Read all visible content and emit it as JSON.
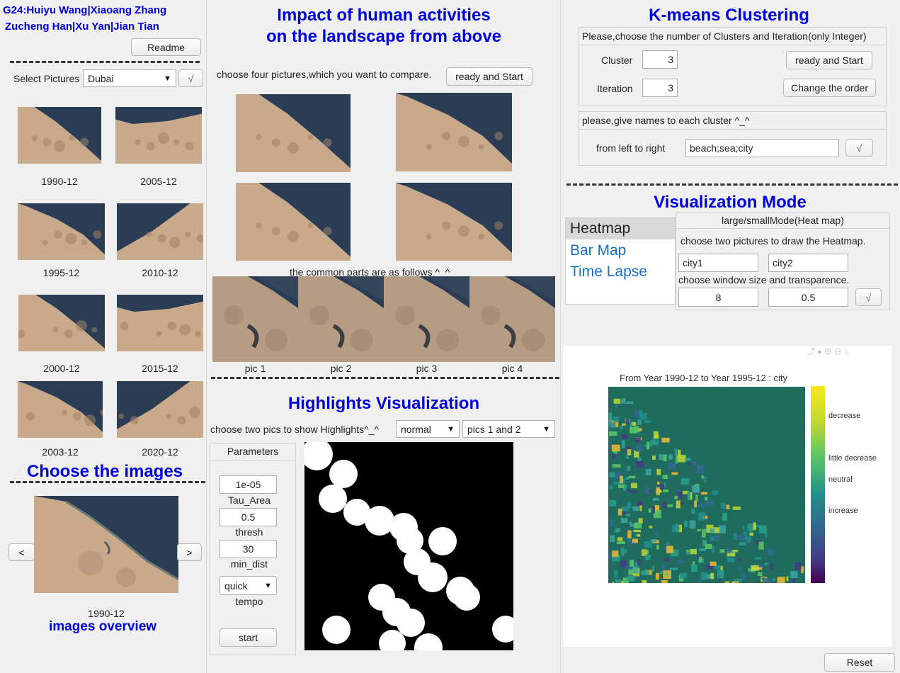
{
  "left": {
    "authors_line1": "G24:Huiyu Wang|Xiaoang Zhang",
    "authors_line2": "Zucheng Han|Xu Yan|Jian Tian",
    "readme_label": "Readme",
    "select_label": "Select Pictures",
    "select_value": "Dubai",
    "confirm_label": "√",
    "thumbnails": [
      "1990-12",
      "2005-12",
      "1995-12",
      "2010-12",
      "2000-12",
      "2015-12",
      "2003-12",
      "2020-12"
    ],
    "choose_title": "Choose the images",
    "prev_label": "<",
    "next_label": ">",
    "preview_caption": "1990-12",
    "overview_title": "images overview"
  },
  "middle": {
    "title_line1": "Impact of human activities",
    "title_line2": "on the landscape from above",
    "choose_text": "choose four pictures,which you want to compare.",
    "ready_label": "ready and Start",
    "common_text": "the common parts are as follows ^_^",
    "pics": [
      "pic 1",
      "pic 2",
      "pic 3",
      "pic 4"
    ],
    "highlights_title": "Highlights Visualization",
    "highlights_text": "choose two pics to show Highlights^_^",
    "mode_value": "normal",
    "pair_value": "pics 1 and 2",
    "params_title": "Parameters",
    "tau_value": "1e-05",
    "tau_label": "Tau_Area",
    "thresh_value": "0.5",
    "thresh_label": "thresh",
    "dist_value": "30",
    "dist_label": "min_dist",
    "tempo_value": "quick",
    "tempo_label": "tempo",
    "start_label": "start"
  },
  "right": {
    "kmeans_title": "K-means Clustering",
    "kmeans_prompt": "Please,choose the number of Clusters and Iteration(only Integer)",
    "cluster_label": "Cluster",
    "cluster_value": "3",
    "iteration_label": "Iteration",
    "iteration_value": "3",
    "ready_label": "ready and Start",
    "order_label": "Change the order",
    "names_prompt": "please,give names to each cluster ^_^",
    "names_label": "from left to right",
    "names_value": "beach;sea;city",
    "names_confirm": "√",
    "viz_title": "Visualization Mode",
    "modes": [
      "Heatmap",
      "Bar Map",
      "Time Lapse"
    ],
    "mode_header": "large/smallMode(Heat map)",
    "heat_prompt": "choose two pictures to draw the Heatmap.",
    "city1": "city1",
    "city2": "city2",
    "window_prompt": "choose window size and transparence.",
    "window_value": "8",
    "transparence_value": "0.5",
    "heat_confirm": "√",
    "heat_title": "From Year 1990-12 to Year 1995-12 : city",
    "colorbar_labels": [
      "decrease",
      "little decrease",
      "neutral",
      "increase"
    ],
    "reset_label": "Reset"
  },
  "colors": {
    "title_blue": "#0000dd",
    "link_blue": "#1a6fc4",
    "heat_bg": "#1f6b5e",
    "sea": "#26384f",
    "sand": "#c8a88a"
  }
}
